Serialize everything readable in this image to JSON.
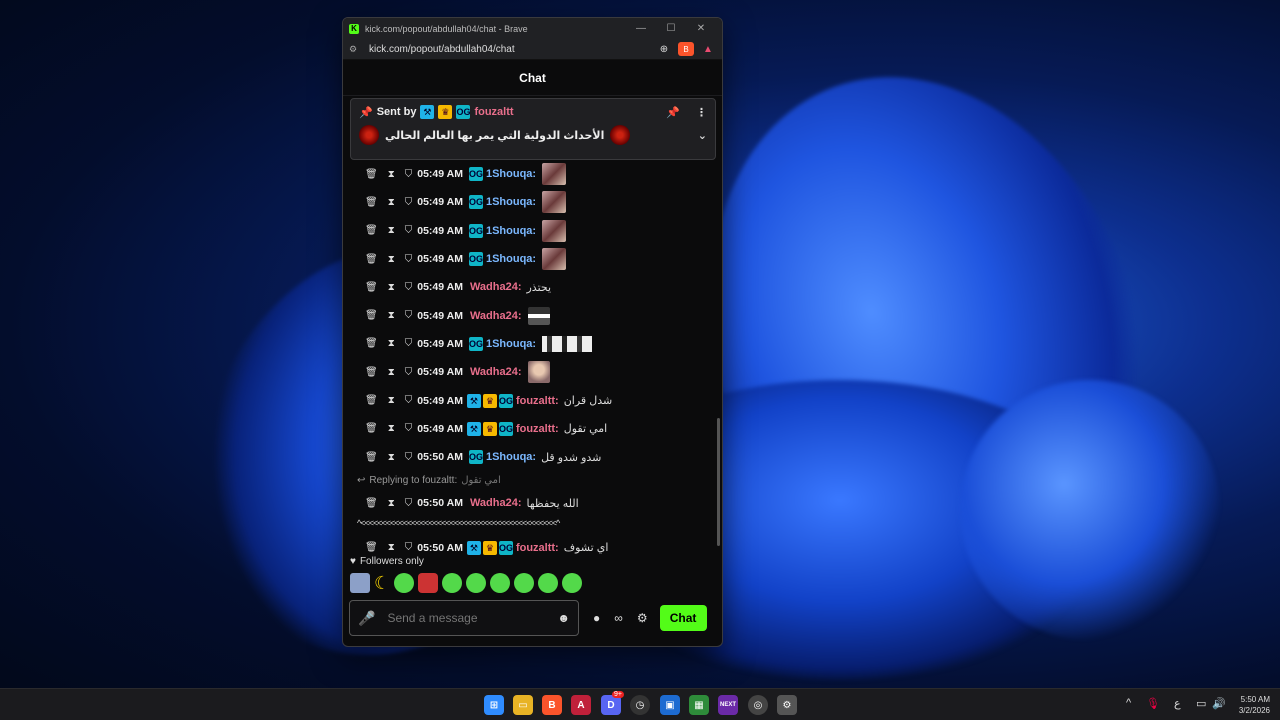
{
  "window": {
    "title": "kick.com/popout/abdullah04/chat - Brave",
    "url": "kick.com/popout/abdullah04/chat",
    "minimize": "—",
    "maximize": "☐",
    "close": "✕"
  },
  "chat": {
    "header": "Chat",
    "pinned": {
      "sent_by_label": "Sent by",
      "user": "fouzaltt",
      "text": "الأحداث الدولية التي يمر بها العالم الحالي"
    },
    "messages": [
      {
        "time": "05:49 AM",
        "user": "1Shouqa:",
        "color": "blue",
        "text": "",
        "emote": "img"
      },
      {
        "time": "05:49 AM",
        "user": "1Shouqa:",
        "color": "blue",
        "text": "",
        "emote": "img"
      },
      {
        "time": "05:49 AM",
        "user": "1Shouqa:",
        "color": "blue",
        "text": "",
        "emote": "img"
      },
      {
        "time": "05:49 AM",
        "user": "1Shouqa:",
        "color": "blue",
        "text": "",
        "emote": "img"
      },
      {
        "time": "05:49 AM",
        "user": "Wadha24:",
        "color": "pink",
        "text": "يحتذر",
        "emote": ""
      },
      {
        "time": "05:49 AM",
        "user": "Wadha24:",
        "color": "pink",
        "text": "",
        "emote": "small"
      },
      {
        "time": "05:49 AM",
        "user": "1Shouqa:",
        "color": "blue",
        "text": "",
        "emote": "wide"
      },
      {
        "time": "05:49 AM",
        "user": "Wadha24:",
        "color": "pink",
        "text": "",
        "emote": "face"
      },
      {
        "time": "05:49 AM",
        "user": "fouzaltt:",
        "color": "pink",
        "text": "شدل قران",
        "emote": "",
        "badges": true
      },
      {
        "time": "05:49 AM",
        "user": "fouzaltt:",
        "color": "pink",
        "text": "امي تقول",
        "emote": "",
        "badges": true
      },
      {
        "time": "05:50 AM",
        "user": "1Shouqa:",
        "color": "blue",
        "text": "شدو شدو قل",
        "emote": ""
      }
    ],
    "reply": {
      "label": "Replying to fouzaltt:",
      "quote": "امي تقول"
    },
    "reply_msg": {
      "time": "05:50 AM",
      "user": "Wadha24:",
      "text": "الله يحفظها"
    },
    "wrap_text": "^<<<<<<<<<<<<<<<<<<<<<<<<<<<<<<<<<<<<<<<<<<<<<<^",
    "last_msg": {
      "time": "05:50 AM",
      "user": "fouzaltt:",
      "text": "اي تشوف"
    },
    "followers_only": "Followers only",
    "input_placeholder": "Send a message",
    "infinity": "∞",
    "send_button": "Chat"
  },
  "taskbar": {
    "clock_time": "5:50 AM",
    "clock_date": "3/2/2026",
    "lang": "ع",
    "tray_up": "^",
    "brave_badge": "9+"
  }
}
